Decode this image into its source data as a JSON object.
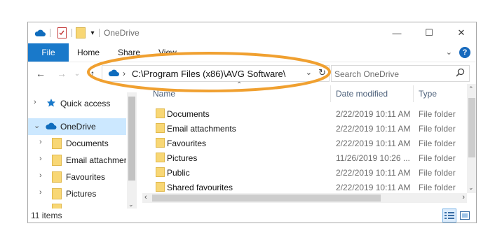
{
  "window": {
    "title": "OneDrive",
    "controls": {
      "minimize": "—",
      "maximize": "☐",
      "close": "✕"
    }
  },
  "ribbon": {
    "tabs": [
      "File",
      "Home",
      "Share",
      "View"
    ],
    "collapse_icon": "chevron-down-icon",
    "help_label": "?"
  },
  "nav": {
    "address_path": "C:\\Program Files (x86)\\AVG Software\\",
    "address_chevron": "›",
    "search_placeholder": "Search OneDrive"
  },
  "columns": {
    "name": "Name",
    "date_modified": "Date modified",
    "type": "Type"
  },
  "navpane": {
    "items": [
      {
        "label": "Quick access",
        "icon": "star-pin-icon",
        "expand": "›",
        "selected": false
      },
      {
        "label": "OneDrive",
        "icon": "cloud-icon",
        "expand": "⌄",
        "selected": true
      },
      {
        "label": "Documents",
        "icon": "folder-icon",
        "expand": "›",
        "selected": false
      },
      {
        "label": "Email attachmer",
        "icon": "folder-icon",
        "expand": "›",
        "selected": false
      },
      {
        "label": "Favourites",
        "icon": "folder-icon",
        "expand": "›",
        "selected": false
      },
      {
        "label": "Pictures",
        "icon": "folder-icon",
        "expand": "›",
        "selected": false
      }
    ]
  },
  "files": [
    {
      "name": "Documents",
      "date": "2/22/2019 10:11 AM",
      "type": "File folder"
    },
    {
      "name": "Email attachments",
      "date": "2/22/2019 10:11 AM",
      "type": "File folder"
    },
    {
      "name": "Favourites",
      "date": "2/22/2019 10:11 AM",
      "type": "File folder"
    },
    {
      "name": "Pictures",
      "date": "11/26/2019 10:26 ...",
      "type": "File folder"
    },
    {
      "name": "Public",
      "date": "2/22/2019 10:11 AM",
      "type": "File folder"
    },
    {
      "name": "Shared favourites",
      "date": "2/22/2019 10:11 AM",
      "type": "File folder"
    }
  ],
  "status": {
    "item_count": "11 items"
  },
  "colors": {
    "accent": "#1979ca",
    "selection": "#cce8ff",
    "annotation": "#f0a030",
    "folder": "#f8d775"
  }
}
